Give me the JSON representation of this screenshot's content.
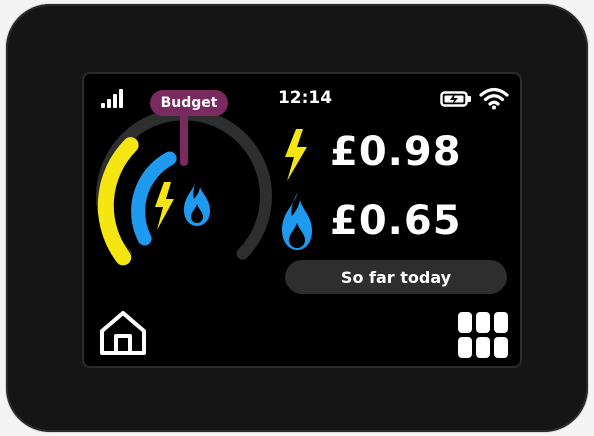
{
  "status": {
    "time": "12:14",
    "signal_icon": "signal-bars-icon",
    "battery_icon": "battery-charging-icon",
    "wifi_icon": "wifi-icon"
  },
  "gauge": {
    "budget_label": "Budget",
    "electricity_color": "#f5e612",
    "gas_color": "#1e9bf0",
    "budget_color": "#7b2a60",
    "track_color": "#2e2e2e"
  },
  "costs": {
    "electricity": "£0.98",
    "gas": "£0.65",
    "period_label": "So far today"
  },
  "nav": {
    "home_icon": "home-icon",
    "menu_icon": "grid-menu-icon"
  }
}
